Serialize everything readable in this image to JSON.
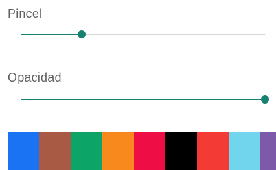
{
  "brush": {
    "label": "Pincel",
    "value_fraction": 0.25
  },
  "opacity": {
    "label": "Opacidad",
    "value_fraction": 1.0
  },
  "accent_color": "#17806f",
  "palette": {
    "colors": [
      "#1a73f2",
      "#a85a44",
      "#0ca467",
      "#f7891d",
      "#ee0d45",
      "#000000",
      "#f33a35",
      "#71d5ee",
      "#7c5aa9"
    ]
  }
}
